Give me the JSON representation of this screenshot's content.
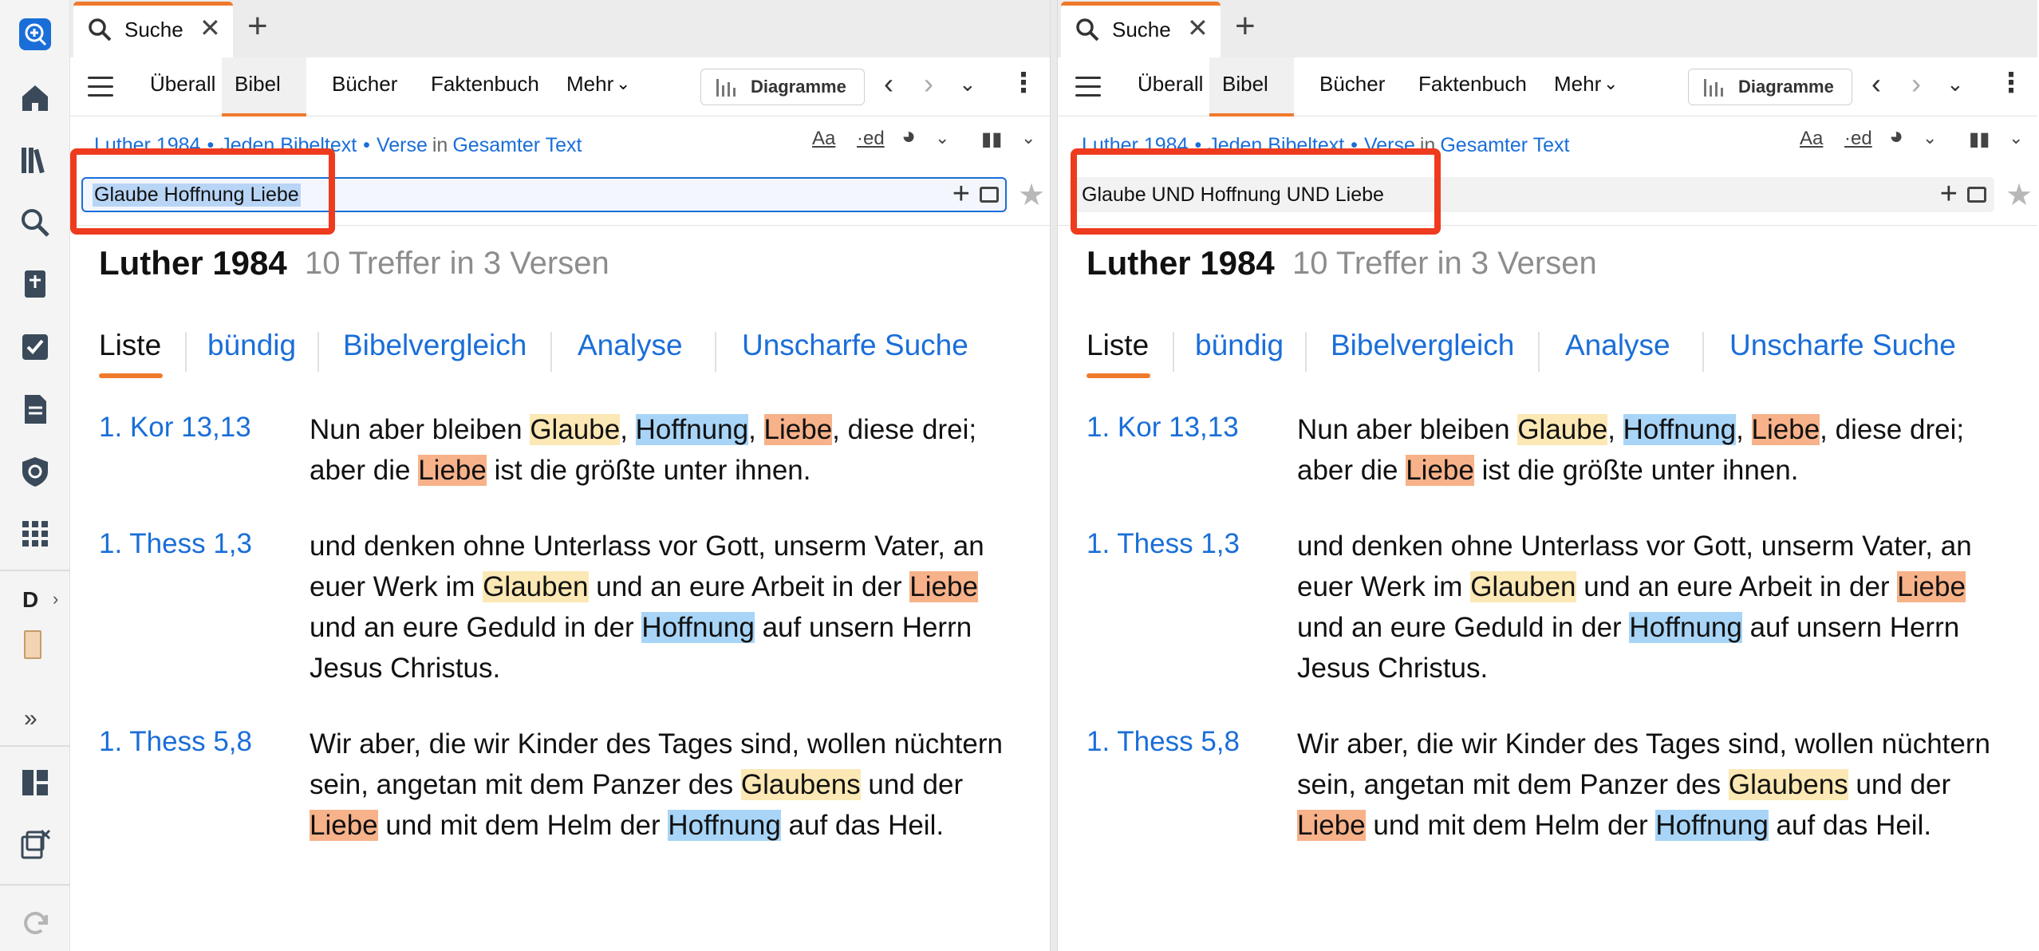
{
  "rail": {
    "icons": [
      "add-search-icon",
      "home-icon",
      "library-icon",
      "search-icon",
      "bible-add-icon",
      "checklist-icon",
      "document-icon",
      "pilot-icon",
      "apps-icon"
    ],
    "letter": "D",
    "chevron": "›",
    "expand": "»",
    "bottom_icons": [
      "layout-icon",
      "close-panels-icon",
      "sync-icon"
    ]
  },
  "panels": [
    {
      "tab": {
        "label": "Suche",
        "close": "✕",
        "add": "+"
      },
      "nav": {
        "items": [
          "Überall",
          "Bibel",
          "Bücher",
          "Faktenbuch",
          "Mehr"
        ],
        "active": "Bibel",
        "more_chevron": "⌄",
        "diagram_label": "Diagramme",
        "back": "‹",
        "forward": "›",
        "history": "⌄",
        "menu": "⋮"
      },
      "crumbs": {
        "bible": "Luther 1984",
        "scope": "Jeden Bibeltext",
        "unit": "Verse",
        "in": "in",
        "range": "Gesamter Text"
      },
      "tools": {
        "font": "Aa",
        "ed": "·ed",
        "pie": "◕",
        "caret": "⌄",
        "split": "▮▮"
      },
      "search": {
        "value": "Glaube Hoffnung Liebe",
        "plus": "+"
      },
      "version": "Luther 1984",
      "hits": "10 Treffer in 3 Versen",
      "subtabs": [
        "Liste",
        "bündig",
        "Bibelvergleich",
        "Analyse",
        "Unscharfe Suche"
      ],
      "results": [
        {
          "ref": "1. Kor 13,13"
        },
        {
          "ref": "1. Thess 1,3"
        },
        {
          "ref": "1. Thess 5,8"
        }
      ]
    },
    {
      "tab": {
        "label": "Suche",
        "close": "✕",
        "add": "+"
      },
      "nav": {
        "items": [
          "Überall",
          "Bibel",
          "Bücher",
          "Faktenbuch",
          "Mehr"
        ],
        "active": "Bibel",
        "more_chevron": "⌄",
        "diagram_label": "Diagramme",
        "back": "‹",
        "forward": "›",
        "history": "⌄",
        "menu": "⋮"
      },
      "crumbs": {
        "bible": "Luther 1984",
        "scope": "Jeden Bibeltext",
        "unit": "Verse",
        "in": "in",
        "range": "Gesamter Text"
      },
      "tools": {
        "font": "Aa",
        "ed": "·ed",
        "pie": "◕",
        "caret": "⌄",
        "split": "▮▮"
      },
      "search": {
        "value": "Glaube UND Hoffnung UND Liebe",
        "plus": "+"
      },
      "version": "Luther 1984",
      "hits": "10 Treffer in 3 Versen",
      "subtabs": [
        "Liste",
        "bündig",
        "Bibelvergleich",
        "Analyse",
        "Unscharfe Suche"
      ],
      "results": [
        {
          "ref": "1. Kor 13,13"
        },
        {
          "ref": "1. Thess 1,3"
        },
        {
          "ref": "1. Thess 5,8"
        }
      ]
    }
  ],
  "verses": [
    [
      {
        "t": "Nun aber bleiben "
      },
      {
        "t": "Glaube",
        "h": "g"
      },
      {
        "t": ", "
      },
      {
        "t": "Hoffnung",
        "h": "h"
      },
      {
        "t": ", "
      },
      {
        "t": "Liebe",
        "h": "l"
      },
      {
        "t": ", diese drei; aber die "
      },
      {
        "t": "Liebe",
        "h": "l"
      },
      {
        "t": " ist die größte unter ihnen."
      }
    ],
    [
      {
        "t": "und denken ohne Unterlass vor Gott, unserm Vater, an euer Werk im "
      },
      {
        "t": "Glauben",
        "h": "g"
      },
      {
        "t": " und an eure Arbeit in der "
      },
      {
        "t": "Liebe",
        "h": "l"
      },
      {
        "t": " und an eure Geduld in der "
      },
      {
        "t": "Hoffnung",
        "h": "h"
      },
      {
        "t": " auf unsern Herrn Jesus Christus."
      }
    ],
    [
      {
        "t": "Wir aber, die wir Kinder des Tages sind, wollen nüchtern sein, angetan mit dem Panzer des "
      },
      {
        "t": "Glaubens",
        "h": "g"
      },
      {
        "t": " und der "
      },
      {
        "t": "Liebe",
        "h": "l"
      },
      {
        "t": " und mit dem Helm der "
      },
      {
        "t": "Hoffnung",
        "h": "h"
      },
      {
        "t": " auf das Heil."
      }
    ]
  ],
  "colors": {
    "accent": "#f07a2c",
    "link": "#1a6ed8",
    "highlight_glaube": "#fbe8b4",
    "highlight_hoffnung": "#a8d5f7",
    "highlight_liebe": "#f7b28a",
    "annotation_box": "#ee3b1d"
  }
}
